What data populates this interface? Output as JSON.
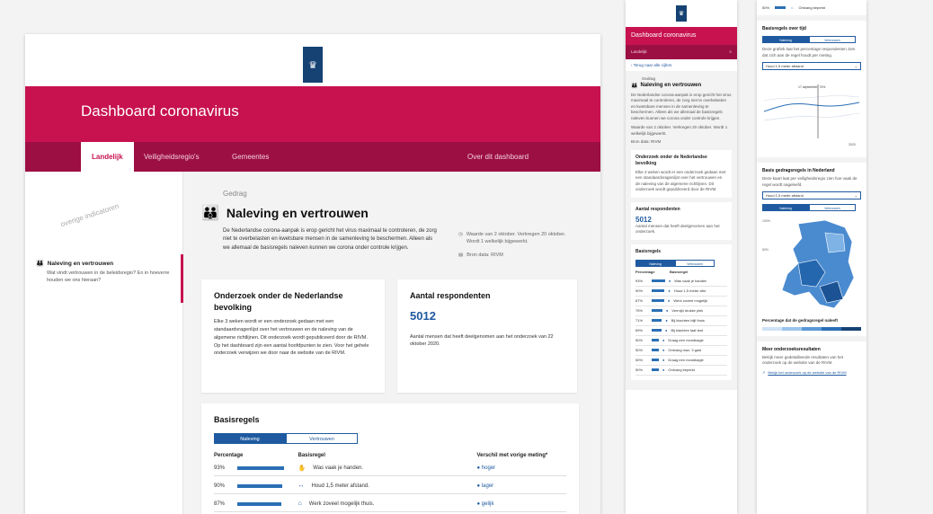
{
  "brand": {
    "primary": "#c7124f",
    "nav": "#9c0f43",
    "accent": "#1f5aa0",
    "logo": "#154273"
  },
  "desktop": {
    "app_title": "Dashboard coronavirus",
    "nav": [
      {
        "label": "Landelijk",
        "active": true
      },
      {
        "label": "Veiligheidsregio's"
      },
      {
        "label": "Gemeentes"
      },
      {
        "label": "Over dit dashboard"
      }
    ],
    "sidebar": {
      "overige": "overige indicatoren",
      "item_title": "Naleving en vertrouwen",
      "item_sub": "Wat vindt vertrouwen in de beleidsregio? En in hoeverre houden we ons hieraan?"
    },
    "main": {
      "category": "Gedrag",
      "title": "Naleving en vertrouwen",
      "intro": "De Nederlandse corona-aanpak is erop gericht het virus maximaal te controleren, de zorg niet te overbelasten en kwetsbare mensen in de samenleving te beschermen. Alleen als we allemaal de basisregels naleven kunnen we corona onder controle krijgen.",
      "meta_dates": "Waarde van 2 oktober. Verkregen 20 oktober. Wordt 1 welkelijk bijgewerkt.",
      "meta_source": "Bron data: RIVM",
      "card1_title": "Onderzoek onder de Nederlandse bevolking",
      "card1_text": "Elke 3 weken wordt er een onderzoek gedaan met een standaardvragenlijst over het vertrouwen en de naleving van de algemene richtlijnen. Dit onderzoek wordt gepubliceerd door de RIVM. Op het dashboard zijn een aantal hoofdpunten te zien. Voor het gehele onderzoek verwijzen we door naar de website van de RIVM.",
      "card2_title": "Aantal respondenten",
      "card2_value": "5012",
      "card2_text": "Aantal mensen dat heeft deelgenomen aan het onderzoek van 22 oktober 2020.",
      "rules_title": "Basisregels",
      "tab_active": "Naleving",
      "tab_other": "Vertrouwen",
      "col_pct": "Percentage",
      "col_rule": "Basisregel",
      "col_change": "Verschil met vorige meting*",
      "rows": [
        {
          "pct": "93%",
          "value": 93,
          "icon": "handwash-icon",
          "glyph": "✋",
          "rule": "Was vaak je handen.",
          "change": "● hoger"
        },
        {
          "pct": "90%",
          "value": 90,
          "icon": "distance-icon",
          "glyph": "↔",
          "rule": "Houd 1,5 meter afstand.",
          "change": "● lager"
        },
        {
          "pct": "87%",
          "value": 87,
          "icon": "home-work-icon",
          "glyph": "⌂",
          "rule": "Werk zoveel mogelijk thuis.",
          "change": "● gelijk"
        }
      ]
    }
  },
  "mobile1": {
    "app_title": "Dashboard coronavirus",
    "subnav": "Landelijk",
    "menu": "≡",
    "back": "‹ Terug naar alle cijfers",
    "category": "Gedrag",
    "title": "Naleving en vertrouwen",
    "intro": "De Nederlandse corona-aanpak is erop gericht het virus maximaal te controleren, de zorg niet te overbelasten en kwetsbare mensen in de samenleving te beschermen. Alleen als we allemaal de basisregels naleven kunnen we corona onder controle krijgen.",
    "meta": "Waarde van 2 oktober. Verkregen 20 oktober. Wordt 1 welkelijk bijgewerkt.",
    "source": "Bron data: RIVM",
    "card1_title": "Onderzoek onder de Nederlandse bevolking",
    "card1_text": "Elke 3 weken wordt er een onderzoek gedaan met een standaardvragenlijst over het vertrouwen en de naleving van de algemene richtlijnen. Dit onderzoek wordt gepubliceerd door de RIVM.",
    "card2_title": "Aantal respondenten",
    "card2_value": "5012",
    "card2_text": "Aantal mensen dat heeft deelgenomen aan het onderzoek.",
    "rules_title": "Basisregels",
    "tab_active": "Naleving",
    "tab_other": "Vertrouwen",
    "col_pct": "Percentage",
    "col_rule": "Basisregel",
    "rows": [
      {
        "pct": "93%",
        "value": 93,
        "icon": "handwash-icon",
        "rule": "Was vaak je handen"
      },
      {
        "pct": "90%",
        "value": 90,
        "icon": "distance-icon",
        "rule": "Houd 1,5 meter afst"
      },
      {
        "pct": "87%",
        "value": 87,
        "icon": "home-work-icon",
        "rule": "Werk zoveel mogelijk"
      },
      {
        "pct": "75%",
        "value": 75,
        "icon": "cough-icon",
        "rule": "Vermijd drukke plek"
      },
      {
        "pct": "71%",
        "value": 71,
        "icon": "visit-icon",
        "rule": "Bij klachten blijf thuis"
      },
      {
        "pct": "69%",
        "value": 69,
        "icon": "test-icon",
        "rule": "Bij klachten laat test"
      },
      {
        "pct": "50%",
        "value": 50,
        "icon": "mask-icon",
        "rule": "Draag een mondkapje"
      },
      {
        "pct": "50%",
        "value": 50,
        "icon": "guests-icon",
        "rule": "Ontvang max. 3 gast"
      },
      {
        "pct": "50%",
        "value": 50,
        "icon": "group-icon",
        "rule": "Draag een mondkapje"
      },
      {
        "pct": "50%",
        "value": 50,
        "icon": "mask-icon",
        "rule": "Ontvang beperkt"
      }
    ]
  },
  "mobile2": {
    "top_pct": "50%",
    "top_rule": "Ontvang beperkt",
    "chart_title": "Basisregels over tijd",
    "tab_active": "Naleving",
    "tab_other": "Vertrouwen",
    "chart_text": "Deze grafiek laat het percentage respondenten zien dat zich aan de regel houdt per meting.",
    "select1": "Houd 1,5 meter afstand",
    "tooltip": "17 september: 74%",
    "y_label_end": "2020",
    "map_title": "Basis gedragsregels in Nederland",
    "map_text": "Deze kaart laat per veiligheidsregio zien hoe vaak de regel wordt nageleefd.",
    "select2": "Houd 1,5 meter afstand",
    "map_tab_active": "Naleving",
    "map_tab_other": "Vertrouwen",
    "map_y1": "100%",
    "map_y2": "50%",
    "legend_title": "Percentage dat de gedragsregel naleeft",
    "more_title": "Meer onderzoeksresultaten",
    "more_text": "Bekijk meer gedetailleerde resultaten van het onderzoek op de website van de RIVM.",
    "more_link": "Bekijk het onderzoek op de website van de RIVM"
  }
}
